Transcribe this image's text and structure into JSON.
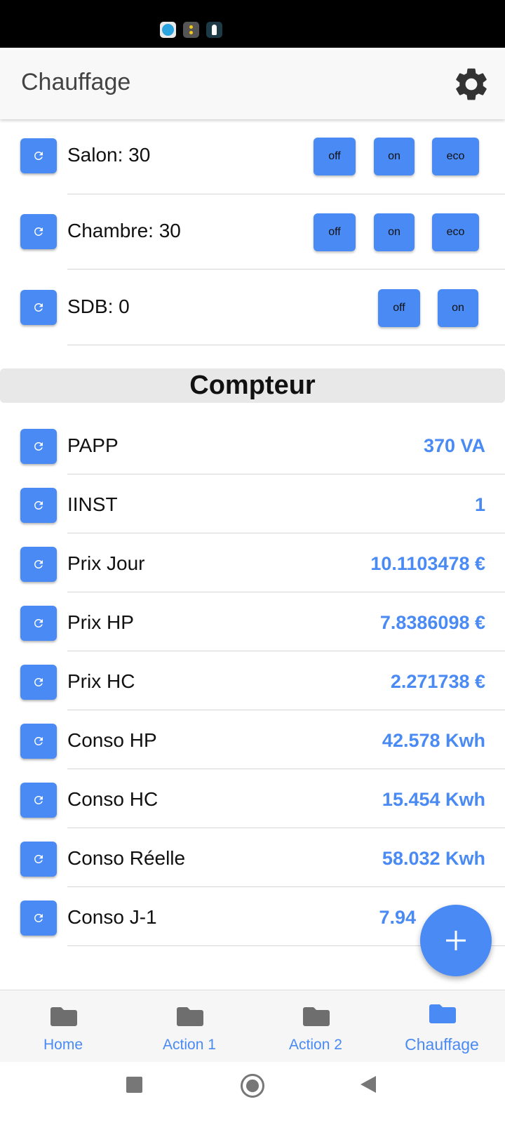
{
  "app_bar": {
    "title": "Chauffage"
  },
  "heaters": [
    {
      "label": "Salon: 30",
      "modes": [
        "off",
        "on",
        "eco"
      ]
    },
    {
      "label": "Chambre: 30",
      "modes": [
        "off",
        "on",
        "eco"
      ]
    },
    {
      "label": "SDB: 0",
      "modes": [
        "off",
        "on"
      ]
    }
  ],
  "compteur": {
    "title": "Compteur",
    "rows": [
      {
        "label": "PAPP",
        "value": "370 VA"
      },
      {
        "label": "IINST",
        "value": "1"
      },
      {
        "label": "Prix Jour",
        "value": "10.1103478 €"
      },
      {
        "label": "Prix HP",
        "value": "7.8386098 €"
      },
      {
        "label": "Prix HC",
        "value": "2.271738 €"
      },
      {
        "label": "Conso HP",
        "value": "42.578 Kwh"
      },
      {
        "label": "Conso HC",
        "value": "15.454 Kwh"
      },
      {
        "label": "Conso Réelle",
        "value": "58.032 Kwh"
      },
      {
        "label": "Conso J-1",
        "value": "7.94"
      }
    ]
  },
  "bottom_nav": {
    "items": [
      {
        "label": "Home",
        "active": false
      },
      {
        "label": "Action 1",
        "active": false
      },
      {
        "label": "Action 2",
        "active": false
      },
      {
        "label": "Chauffage",
        "active": true
      }
    ]
  },
  "colors": {
    "accent": "#4a8af4",
    "inactive_icon": "#6e6e6e"
  }
}
